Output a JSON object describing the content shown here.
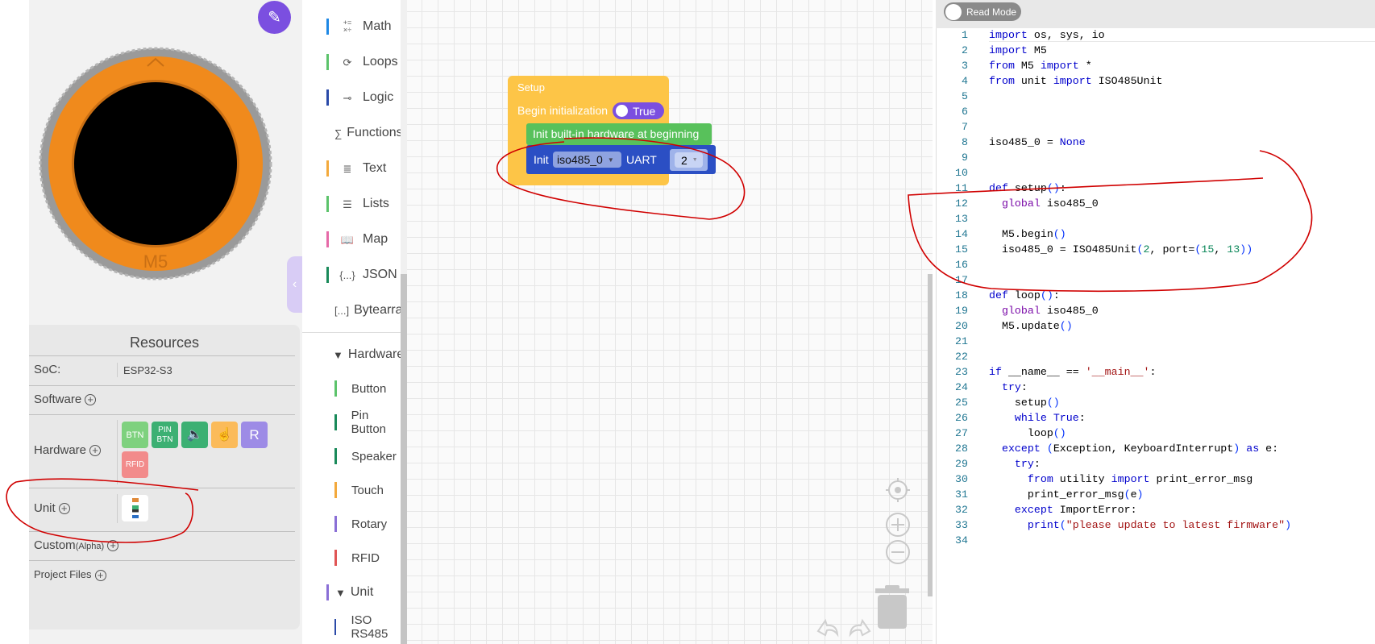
{
  "device": {
    "brand_mark": "M5",
    "edit_button_icon": "pencil-ruler-icon"
  },
  "resources": {
    "title": "Resources",
    "soc_label": "SoC:",
    "soc_value": "ESP32-S3",
    "software_label": "Software",
    "hardware_label": "Hardware",
    "hardware_items": [
      {
        "label": "BTN",
        "color": "#7ed17e"
      },
      {
        "label": "PIN BTN",
        "color": "#3cb073"
      },
      {
        "label": "speaker-icon",
        "color": "#3cb073"
      },
      {
        "label": "touch-icon",
        "color": "#fbbb5a"
      },
      {
        "label": "R",
        "color": "#9d8be6"
      },
      {
        "label": "RFID",
        "color": "#f28b8b"
      }
    ],
    "unit_label": "Unit",
    "custom_label": "Custom",
    "custom_tag": "(Alpha)",
    "project_files_label": "Project Files"
  },
  "categories": [
    {
      "label": "Math",
      "icon": "+=\n×÷",
      "color": "#1e88e5"
    },
    {
      "label": "Loops",
      "icon": "⟳",
      "color": "#5cc36b"
    },
    {
      "label": "Logic",
      "icon": "⊸",
      "color": "#2a4aa8"
    },
    {
      "label": "Functions",
      "icon": "∑",
      "color": "#8a6fd6"
    },
    {
      "label": "Text",
      "icon": "≣",
      "color": "#f3a93c"
    },
    {
      "label": "Lists",
      "icon": "☰",
      "color": "#5cc36b"
    },
    {
      "label": "Map",
      "icon": "📖",
      "color": "#e66aa8"
    },
    {
      "label": "JSON",
      "icon": "{...}",
      "color": "#1a8a5a"
    },
    {
      "label": "Bytearray",
      "icon": "[...]",
      "color": "#1e88e5"
    }
  ],
  "hardware_group": {
    "label": "Hardware",
    "items": [
      {
        "label": "Button",
        "color": "#5cc36b"
      },
      {
        "label": "Pin Button",
        "color": "#1a8a5a"
      },
      {
        "label": "Speaker",
        "color": "#1a8a5a"
      },
      {
        "label": "Touch",
        "color": "#f3a93c"
      },
      {
        "label": "Rotary",
        "color": "#8a6fd6"
      },
      {
        "label": "RFID",
        "color": "#e05555"
      }
    ]
  },
  "unit_group": {
    "label": "Unit",
    "items": [
      {
        "label": "ISO RS485",
        "color": "#2a4aa8"
      }
    ]
  },
  "blocks": {
    "setup_title": "Setup",
    "begin_label": "Begin initialization",
    "begin_value": "True",
    "init_builtin": "Init built-in hardware at beginning",
    "init_label": "Init",
    "init_var": "iso485_0",
    "uart_label": "UART",
    "uart_value": "2"
  },
  "editor": {
    "read_mode_label": "Read Mode",
    "lines": [
      [
        [
          "import",
          "kw"
        ],
        [
          " os, sys, io",
          ""
        ]
      ],
      [
        [
          "import",
          "kw"
        ],
        [
          " M5",
          ""
        ]
      ],
      [
        [
          "from",
          "kw"
        ],
        [
          " M5 ",
          ""
        ],
        [
          "import",
          "kw"
        ],
        [
          " *",
          ""
        ]
      ],
      [
        [
          "from",
          "kw"
        ],
        [
          " unit ",
          ""
        ],
        [
          "import",
          "kw"
        ],
        [
          " ISO485Unit",
          ""
        ]
      ],
      [],
      [],
      [],
      [
        [
          "iso485_0 = ",
          ""
        ],
        [
          "None",
          "kw"
        ]
      ],
      [],
      [],
      [
        [
          "def",
          "def"
        ],
        [
          " setup",
          ""
        ],
        [
          "()",
          "p"
        ],
        [
          ":",
          ""
        ]
      ],
      [
        [
          "  ",
          ""
        ],
        [
          "global",
          "g"
        ],
        [
          " iso485_0",
          ""
        ]
      ],
      [],
      [
        [
          "  M5.begin",
          ""
        ],
        [
          "()",
          "p"
        ]
      ],
      [
        [
          "  iso485_0 = ISO485Unit",
          ""
        ],
        [
          "(",
          "p"
        ],
        [
          "2",
          "num"
        ],
        [
          ", port=",
          ""
        ],
        [
          "(",
          "p"
        ],
        [
          "15",
          "num"
        ],
        [
          ", ",
          ""
        ],
        [
          "13",
          "num"
        ],
        [
          "))",
          "p"
        ]
      ],
      [],
      [],
      [
        [
          "def",
          "def"
        ],
        [
          " loop",
          ""
        ],
        [
          "()",
          "p"
        ],
        [
          ":",
          ""
        ]
      ],
      [
        [
          "  ",
          ""
        ],
        [
          "global",
          "g"
        ],
        [
          " iso485_0",
          ""
        ]
      ],
      [
        [
          "  M5.update",
          ""
        ],
        [
          "()",
          "p"
        ]
      ],
      [],
      [],
      [
        [
          "if",
          "kw"
        ],
        [
          " __name__ == ",
          ""
        ],
        [
          "'__main__'",
          "str"
        ],
        [
          ":",
          ""
        ]
      ],
      [
        [
          "  ",
          ""
        ],
        [
          "try",
          "kw"
        ],
        [
          ":",
          ""
        ]
      ],
      [
        [
          "    setup",
          ""
        ],
        [
          "()",
          "p"
        ]
      ],
      [
        [
          "    ",
          ""
        ],
        [
          "while",
          "kw"
        ],
        [
          " ",
          ""
        ],
        [
          "True",
          "kw"
        ],
        [
          ":",
          ""
        ]
      ],
      [
        [
          "      loop",
          ""
        ],
        [
          "()",
          "p"
        ]
      ],
      [
        [
          "  ",
          ""
        ],
        [
          "except",
          "kw"
        ],
        [
          " ",
          ""
        ],
        [
          "(",
          "p"
        ],
        [
          "Exception, KeyboardInterrupt",
          ""
        ],
        [
          ")",
          "p"
        ],
        [
          " ",
          ""
        ],
        [
          "as",
          "kw"
        ],
        [
          " e:",
          ""
        ]
      ],
      [
        [
          "    ",
          ""
        ],
        [
          "try",
          "kw"
        ],
        [
          ":",
          ""
        ]
      ],
      [
        [
          "      ",
          ""
        ],
        [
          "from",
          "kw"
        ],
        [
          " utility ",
          ""
        ],
        [
          "import",
          "kw"
        ],
        [
          " print_error_msg",
          ""
        ]
      ],
      [
        [
          "      print_error_msg",
          ""
        ],
        [
          "(",
          "p"
        ],
        [
          "e",
          ""
        ],
        [
          ")",
          "p"
        ]
      ],
      [
        [
          "    ",
          ""
        ],
        [
          "except",
          "kw"
        ],
        [
          " ImportError:",
          ""
        ]
      ],
      [
        [
          "      ",
          ""
        ],
        [
          "print",
          "kw"
        ],
        [
          "(",
          "p"
        ],
        [
          "\"please update to latest firmware\"",
          "str"
        ],
        [
          ")",
          "p"
        ]
      ],
      []
    ]
  },
  "colors": {
    "accent": "#7b4fe0",
    "setup_block": "#fdc547",
    "init_block": "#58c15b",
    "unit_block": "#2b4fc4",
    "annotation": "#d00000"
  }
}
